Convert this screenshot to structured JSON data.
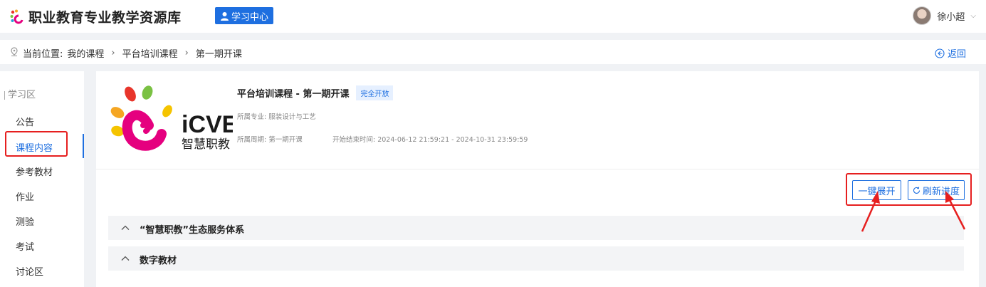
{
  "header": {
    "site_title": "职业教育专业教学资源库",
    "study_center_label": "学习中心",
    "user_name": "徐小超"
  },
  "breadcrumb": {
    "prefix": "当前位置:",
    "items": [
      "我的课程",
      "平台培训课程",
      "第一期开课"
    ],
    "back_label": "返回"
  },
  "sidebar": {
    "section_title": "学习区",
    "items": [
      {
        "label": "公告"
      },
      {
        "label": "课程内容",
        "active": true
      },
      {
        "label": "参考教材"
      },
      {
        "label": "作业"
      },
      {
        "label": "测验"
      },
      {
        "label": "考试"
      },
      {
        "label": "讨论区"
      }
    ]
  },
  "course": {
    "title": "平台培训课程 - 第一期开课",
    "status_tag": "完全开放",
    "major": "所属专业: 服装设计与工艺",
    "period": "所属周期: 第一期开课",
    "time_range": "开始结束时间: 2024-06-12 21:59:21 - 2024-10-31 23:59:59",
    "logo_text_main": "iCVE",
    "logo_text_sub": "智慧职教"
  },
  "actions": {
    "expand_all_label": "一键展开",
    "refresh_progress_label": "刷新进度"
  },
  "sections": [
    {
      "title": "“智慧职教”生态服务体系"
    },
    {
      "title": "数字教材"
    }
  ],
  "colors": {
    "accent": "#1e6fe0",
    "highlight": "#e61f1f"
  }
}
